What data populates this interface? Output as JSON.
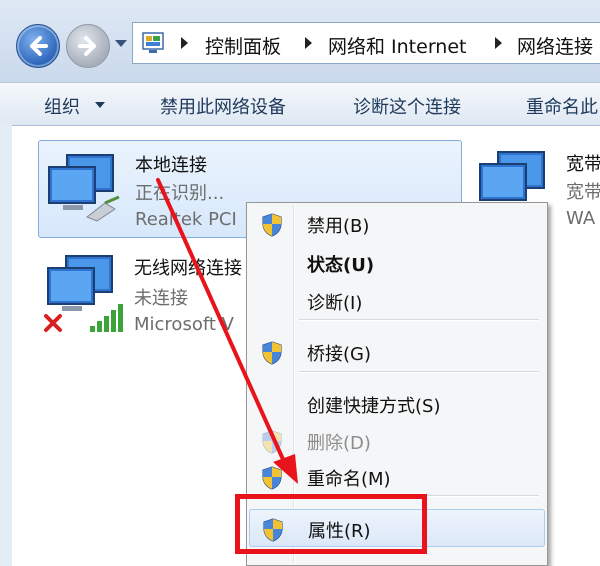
{
  "breadcrumb": {
    "items": [
      "控制面板",
      "网络和 Internet",
      "网络连接"
    ]
  },
  "toolbar": {
    "organize": "组织",
    "disable_device": "禁用此网络设备",
    "diagnose": "诊断这个连接",
    "rename": "重命名此"
  },
  "connections": [
    {
      "name": "本地连接",
      "status": "正在识别...",
      "device": "Realtek PCI"
    },
    {
      "name": "无线网络连接",
      "status": "未连接",
      "device": "Microsoft V"
    },
    {
      "name": "宽带",
      "status": "宽带",
      "device": "WA"
    }
  ],
  "context_menu": {
    "items": [
      {
        "label": "禁用(B)",
        "shield": true,
        "bold": false,
        "disabled": false
      },
      {
        "label": "状态(U)",
        "shield": false,
        "bold": true,
        "disabled": false
      },
      {
        "label": "诊断(I)",
        "shield": false,
        "bold": false,
        "disabled": false
      },
      {
        "label": "桥接(G)",
        "shield": true,
        "bold": false,
        "disabled": false
      },
      {
        "label": "创建快捷方式(S)",
        "shield": false,
        "bold": false,
        "disabled": false
      },
      {
        "label": "删除(D)",
        "shield": true,
        "bold": false,
        "disabled": true
      },
      {
        "label": "重命名(M)",
        "shield": true,
        "bold": false,
        "disabled": false
      },
      {
        "label": "属性(R)",
        "shield": true,
        "bold": false,
        "disabled": false,
        "highlighted": true
      }
    ]
  },
  "colors": {
    "annotation_red": "#e8131b",
    "selection_blue": "#84acdd"
  }
}
